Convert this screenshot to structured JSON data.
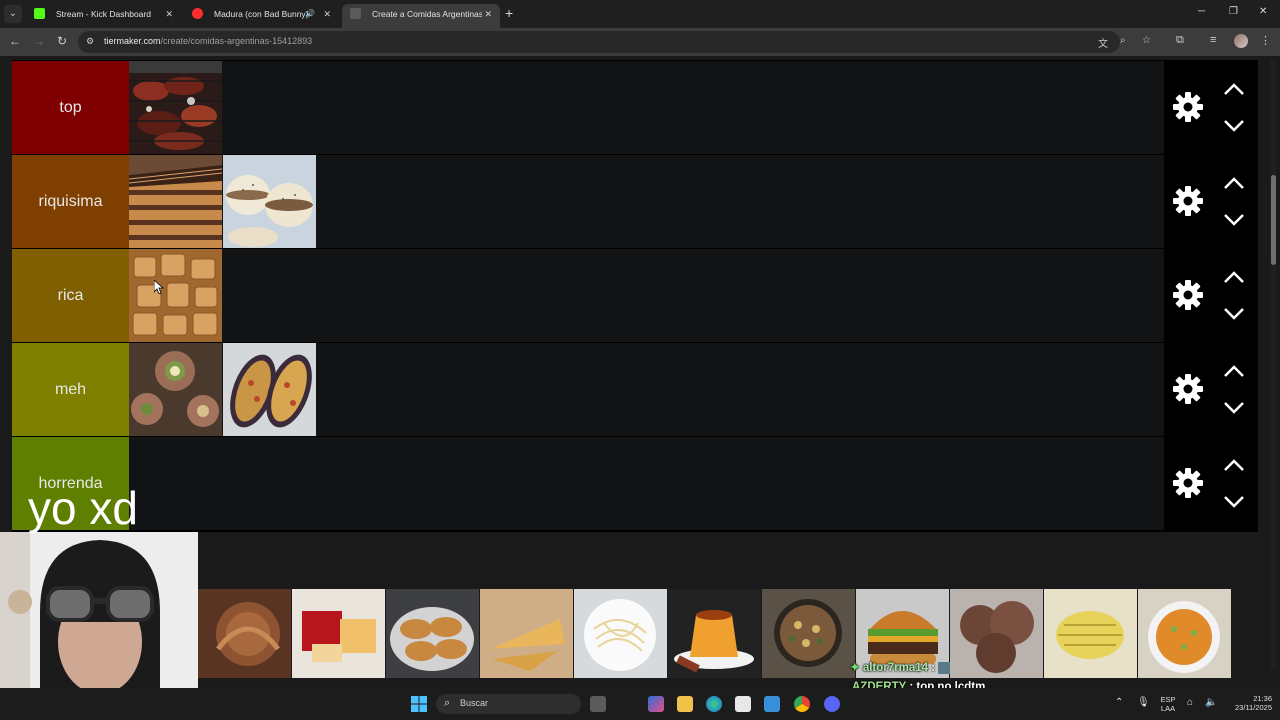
{
  "browser": {
    "tabs": [
      {
        "label": "Stream - Kick Dashboard",
        "favicon_color": "#53fc18",
        "active": false
      },
      {
        "label": "Madura (con Bad Bunny) - Y",
        "favicon_color": "#ff2e2e",
        "active": false
      },
      {
        "label": "Create a Comidas Argentinas Ti",
        "favicon_color": "#777777",
        "active": true
      }
    ],
    "new_tab_label": "+",
    "url_domain": "tiermaker.com",
    "url_path": "/create/comidas-argentinas-15412893"
  },
  "tiers": [
    {
      "label": "top",
      "color": "#7f0000",
      "items": [
        "asado-image"
      ]
    },
    {
      "label": "riquisima",
      "color": "#7f3f00",
      "items": [
        "chocotorta-image",
        "alfajores-image"
      ]
    },
    {
      "label": "rica",
      "color": "#7f5f00",
      "items": [
        "facturas-image"
      ]
    },
    {
      "label": "meh",
      "color": "#7f7f00",
      "items": [
        "matambre-image",
        "berenjenas-image"
      ]
    },
    {
      "label": "horrenda",
      "color": "#5f7f00",
      "items": []
    }
  ],
  "overlay_text": "yo xd",
  "pool_items": [
    "dulce-de-leche-image",
    "queso-y-dulce-image",
    "empanadas-image",
    "faina-image",
    "pasta-image",
    "flan-image",
    "locro-image",
    "hamburguesa-image",
    "helado-image",
    "humita-image",
    "sopa-image"
  ],
  "chat": [
    {
      "user": "altor7rma14",
      "message": ""
    },
    {
      "user": "AZDERTY",
      "message": "top no lcdtm"
    },
    {
      "user": "altor7rma14",
      "message": ""
    }
  ],
  "taskbar": {
    "search_placeholder": "Buscar",
    "lang_top": "ESP",
    "lang_bottom": "LAA",
    "time": "21:36",
    "date": "23/11/2025"
  }
}
